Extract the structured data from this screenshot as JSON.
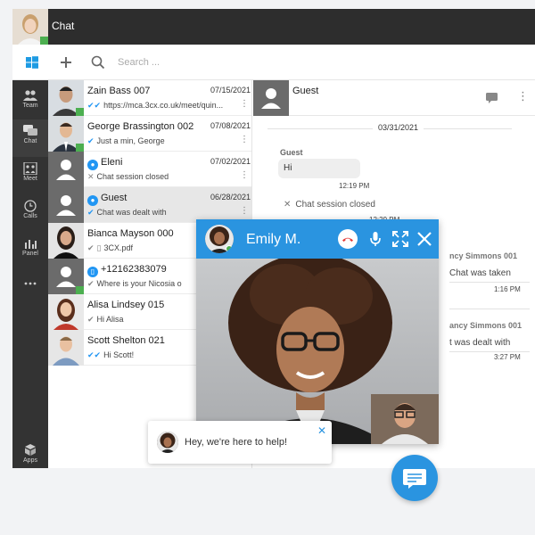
{
  "header": {
    "title": "Chat"
  },
  "toolbar": {
    "search_placeholder": "Search ..."
  },
  "nav": [
    {
      "label": "Team",
      "icon": "team-icon"
    },
    {
      "label": "Chat",
      "icon": "chat-icon"
    },
    {
      "label": "Meet",
      "icon": "meet-icon"
    },
    {
      "label": "Calls",
      "icon": "calls-icon"
    },
    {
      "label": "Panel",
      "icon": "panel-icon"
    },
    {
      "label": "",
      "icon": "more-icon"
    },
    {
      "label": "Apps",
      "icon": "apps-icon"
    }
  ],
  "chats": [
    {
      "name": "Zain Bass 007",
      "date": "07/15/2021",
      "preview": "https://mca.3cx.co.uk/meet/quin...",
      "status": "read"
    },
    {
      "name": "George Brassington 002",
      "date": "07/08/2021",
      "preview": "Just a min, George",
      "status": "sent"
    },
    {
      "name": "Eleni",
      "date": "07/02/2021",
      "preview": "Chat session closed",
      "status": "closed"
    },
    {
      "name": "Guest",
      "date": "06/28/2021",
      "preview": "Chat was dealt with",
      "status": "sent"
    },
    {
      "name": "Bianca Mayson 000",
      "date": "",
      "preview": "3CX.pdf",
      "status": "sent"
    },
    {
      "name": "+12162383079",
      "date": "",
      "preview": "Where is your Nicosia o",
      "status": "sent"
    },
    {
      "name": "Alisa Lindsey 015",
      "date": "",
      "preview": "Hi Alisa",
      "status": "sent"
    },
    {
      "name": "Scott Shelton 021",
      "date": "",
      "preview": "Hi Scott!",
      "status": "read"
    }
  ],
  "conversation": {
    "title": "Guest",
    "date": "03/31/2021",
    "sender": "Guest",
    "message": "Hi",
    "message_time": "12:19 PM",
    "system_message": "Chat session closed",
    "system_time": "12:29 PM",
    "right_sender_1": "ncy Simmons 001",
    "right_msg_1": "Chat was taken",
    "right_time_1": "1:16 PM",
    "right_sender_2": "ancy Simmons 001",
    "right_msg_2": "t was dealt with",
    "right_time_2": "3:27 PM"
  },
  "video_call": {
    "name": "Emily M."
  },
  "help_popup": {
    "text": "Hey, we're here to help!"
  },
  "colors": {
    "accent": "#2a94e0",
    "online": "#4caf50",
    "dark": "#2d2d2d"
  }
}
